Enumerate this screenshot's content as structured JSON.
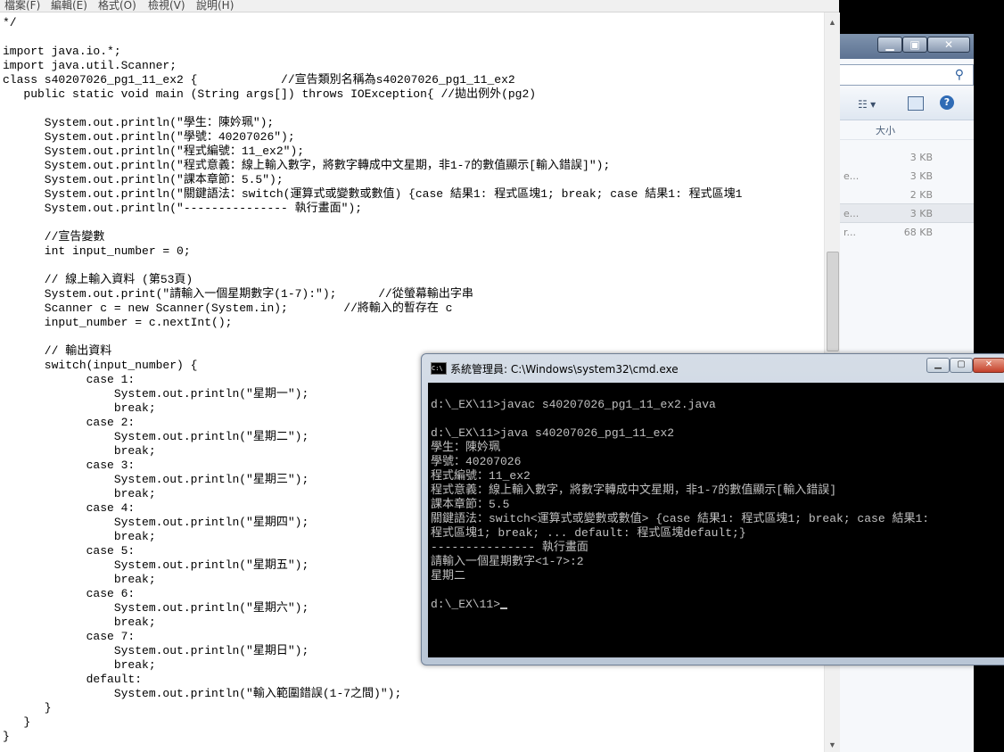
{
  "notepad": {
    "menu": [
      "檔案(F)",
      "編輯(E)",
      "格式(O)",
      "檢視(V)",
      "說明(H)"
    ],
    "code": "*/\n\nimport java.io.*;\nimport java.util.Scanner;\nclass s40207026_pg1_11_ex2 {            //宣告類別名稱為s40207026_pg1_11_ex2\n   public static void main (String args[]) throws IOException{ //拋出例外(pg2)\n\n      System.out.println(\"學生：陳妗珮\");\n      System.out.println(\"學號：40207026\");\n      System.out.println(\"程式編號：11_ex2\");\n      System.out.println(\"程式意義：線上輸入數字，將數字轉成中文星期，非1-7的數值顯示[輸入錯誤]\");\n      System.out.println(\"課本章節：5.5\");\n      System.out.println(\"關鍵語法：switch(運算式或變數或數值) {case 結果1: 程式區塊1; break; case 結果1: 程式區塊1\n      System.out.println(\"--------------- 執行畫面\");\n\n      //宣告變數\n      int input_number = 0;\n\n      // 線上輸入資料 (第53頁)\n      System.out.print(\"請輸入一個星期數字(1-7):\");      //從螢幕輸出字串\n      Scanner c = new Scanner(System.in);        //將輸入的暫存在 c\n      input_number = c.nextInt();\n\n      // 輸出資料\n      switch(input_number) {\n            case 1:\n                System.out.println(\"星期一\");\n                break;\n            case 2:\n                System.out.println(\"星期二\");\n                break;\n            case 3:\n                System.out.println(\"星期三\");\n                break;\n            case 4:\n                System.out.println(\"星期四\");\n                break;\n            case 5:\n                System.out.println(\"星期五\");\n                break;\n            case 6:\n                System.out.println(\"星期六\");\n                break;\n            case 7:\n                System.out.println(\"星期日\");\n                break;\n            default:\n                System.out.println(\"輸入範圍錯誤(1-7之間)\");\n      }\n   }\n}"
  },
  "cmd": {
    "title": "系統管理員: C:\\Windows\\system32\\cmd.exe",
    "output": "d:\\_EX\\11>javac s40207026_pg1_11_ex2.java\n\nd:\\_EX\\11>java s40207026_pg1_11_ex2\n學生：陳妗珮\n學號：40207026\n程式編號：11_ex2\n程式意義：線上輸入數字，將數字轉成中文星期，非1-7的數值顯示[輸入錯誤]\n課本章節：5.5\n關鍵語法：switch<運算式或變數或數值> {case 結果1: 程式區塊1; break; case 結果1:\n程式區塊1; break; ... default: 程式區塊default;}\n--------------- 執行畫面\n請輸入一個星期數字<1-7>:2\n星期二\n\n",
    "prompt": "d:\\_EX\\11>"
  },
  "explorer": {
    "column_header": "大小",
    "rows": [
      {
        "name": "",
        "size": "3 KB"
      },
      {
        "name": "e...",
        "size": "3 KB"
      },
      {
        "name": "",
        "size": "2 KB"
      },
      {
        "name": "e...",
        "size": "3 KB"
      },
      {
        "name": "r...",
        "size": "68 KB"
      }
    ]
  }
}
